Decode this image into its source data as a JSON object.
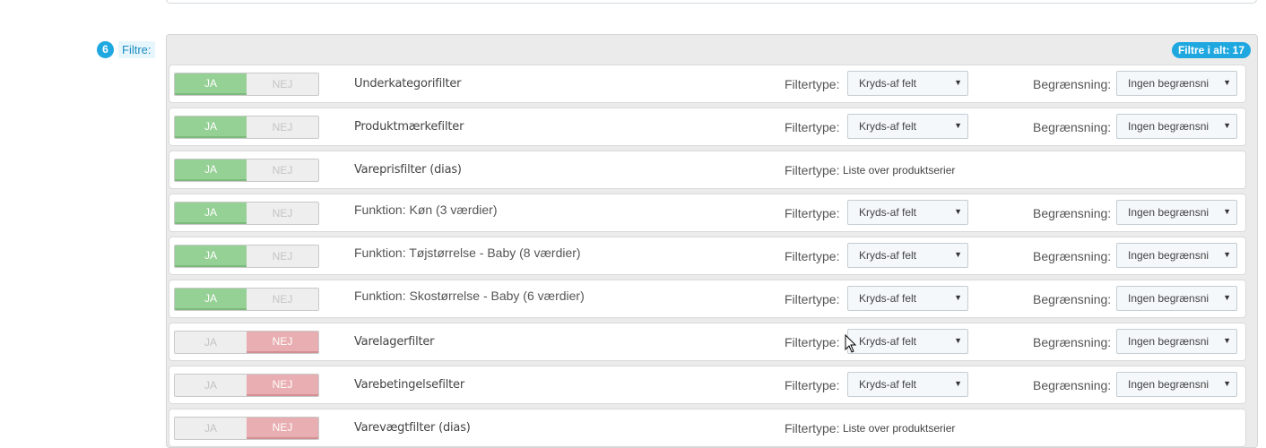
{
  "step": {
    "number": "6",
    "label": "Filtre:"
  },
  "total_badge": "Filtre i alt: 17",
  "toggle_labels": {
    "yes": "JA",
    "no": "NEJ"
  },
  "type_label": "Filtertype:",
  "limit_label": "Begrænsning:",
  "rows": [
    {
      "name": "Underkategorifilter",
      "enabled": true,
      "type": "Kryds-af felt",
      "limit": "Ingen begrænsni"
    },
    {
      "name": "Produktmærkefilter",
      "enabled": true,
      "type": "Kryds-af felt",
      "limit": "Ingen begrænsni"
    },
    {
      "name": "Vareprisfilter (dias)",
      "enabled": true,
      "type_static": "Liste over produktserier"
    },
    {
      "name": "Funktion: Køn (3 værdier)",
      "enabled": true,
      "type": "Kryds-af felt",
      "limit": "Ingen begrænsni"
    },
    {
      "name": "Funktion: Tøjstørrelse - Baby (8 værdier)",
      "enabled": true,
      "type": "Kryds-af felt",
      "limit": "Ingen begrænsni"
    },
    {
      "name": "Funktion: Skostørrelse - Baby (6 værdier)",
      "enabled": true,
      "type": "Kryds-af felt",
      "limit": "Ingen begrænsni"
    },
    {
      "name": "Varelagerfilter",
      "enabled": false,
      "type": "Kryds-af felt",
      "limit": "Ingen begrænsni"
    },
    {
      "name": "Varebetingelsefilter",
      "enabled": false,
      "type": "Kryds-af felt",
      "limit": "Ingen begrænsni"
    },
    {
      "name": "Varevægtfilter (dias)",
      "enabled": false,
      "type_static": "Liste over produktserier"
    }
  ],
  "colors": {
    "accent": "#1fa8e0",
    "yes_on": "#95d095",
    "no_on": "#e9aeb1"
  }
}
